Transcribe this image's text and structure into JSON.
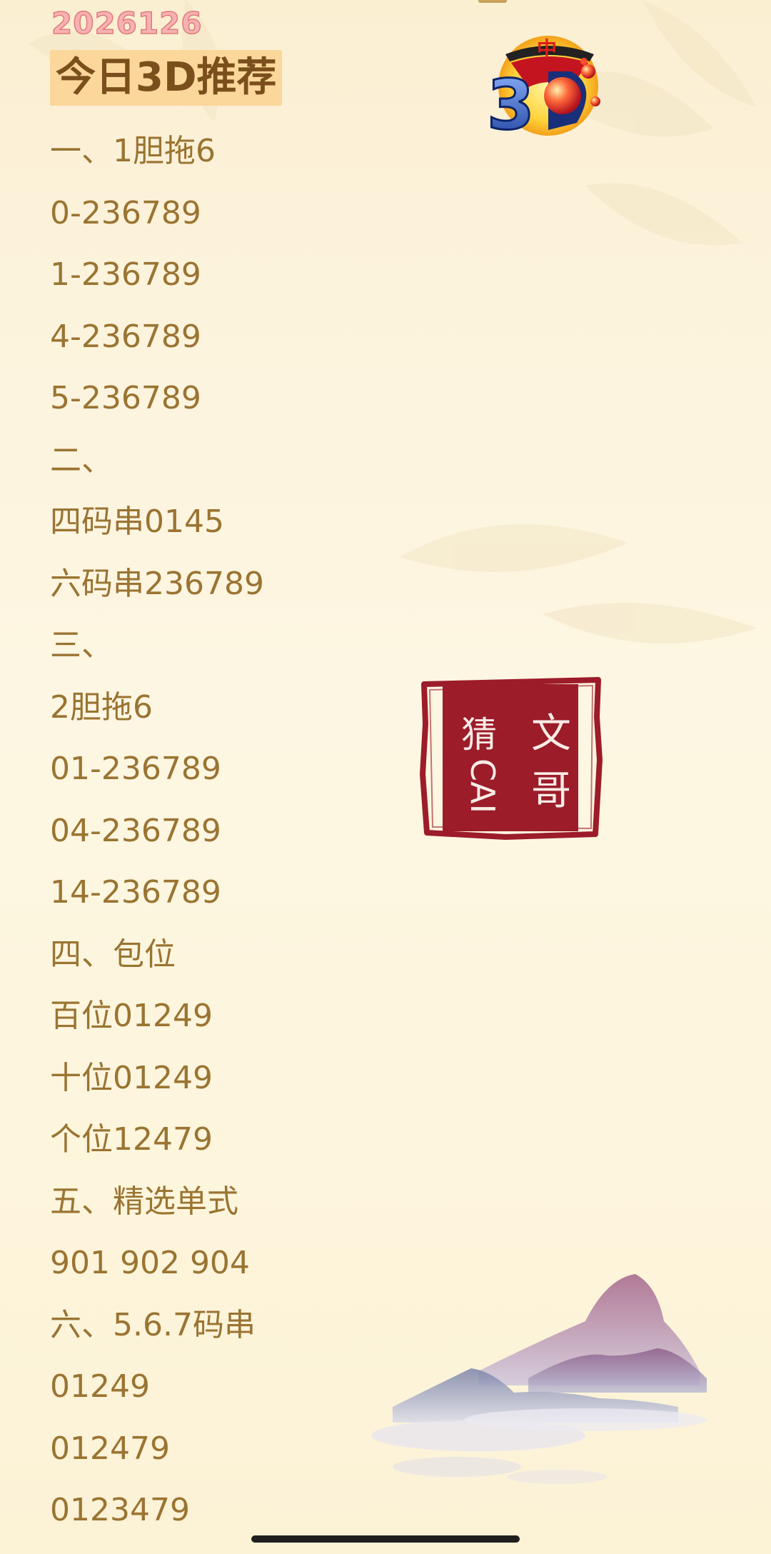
{
  "header": {
    "date": "2026126",
    "title": "今日3D推荐"
  },
  "content_lines": [
    "一、1胆拖6",
    "0-236789",
    "1-236789",
    "4-236789",
    "5-236789",
    "二、",
    "四码串0145",
    "六码串236789",
    "三、",
    "2胆拖6",
    "01-236789",
    "04-236789",
    "14-236789",
    "四、包位",
    "百位01249",
    "十位01249",
    "个位12479",
    "五、精选单式",
    "901 902 904",
    "六、5.6.7码串",
    "01249",
    "012479",
    "0123479"
  ],
  "logo": {
    "text": "3D",
    "top_char": "中",
    "icon": "lottery-3d-logo-icon"
  },
  "seal": {
    "text": "文哥猜CAI",
    "icon": "red-seal-stamp-icon"
  },
  "decoration": {
    "icon": "ink-mountain-landscape-icon"
  },
  "colors": {
    "text": "#9a7432",
    "headline_bg": "#fcd79b",
    "headline_text": "#7a4f1c",
    "seal_red": "#9c1c2a",
    "date_pink": "#f6b2b2"
  }
}
